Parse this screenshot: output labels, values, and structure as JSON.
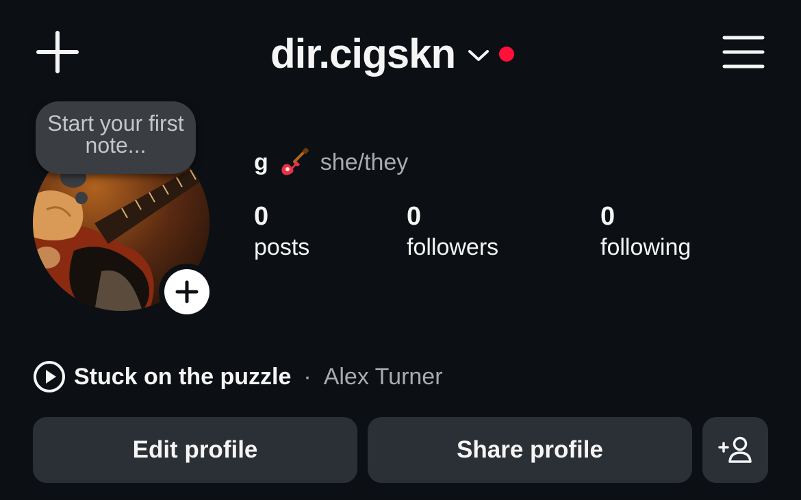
{
  "header": {
    "username": "dir.cigskn",
    "add_icon": "plus-icon",
    "menu_icon": "hamburger-menu-icon",
    "notification_dot_color": "#ff0f3a"
  },
  "note": {
    "placeholder": "Start your first note..."
  },
  "profile": {
    "name": "g",
    "name_emoji_icon": "guitar-icon",
    "pronouns": "she/they"
  },
  "stats": {
    "posts": {
      "count": "0",
      "label": "posts"
    },
    "followers": {
      "count": "0",
      "label": "followers"
    },
    "following": {
      "count": "0",
      "label": "following"
    }
  },
  "music": {
    "song": "Stuck on the puzzle",
    "separator": "·",
    "artist": "Alex Turner",
    "icon": "play-circle-icon"
  },
  "actions": {
    "edit_label": "Edit profile",
    "share_label": "Share profile",
    "discover_icon": "add-person-icon"
  },
  "colors": {
    "background": "#0c1014",
    "button": "#2b3036",
    "secondary_text": "#a8abb0"
  }
}
